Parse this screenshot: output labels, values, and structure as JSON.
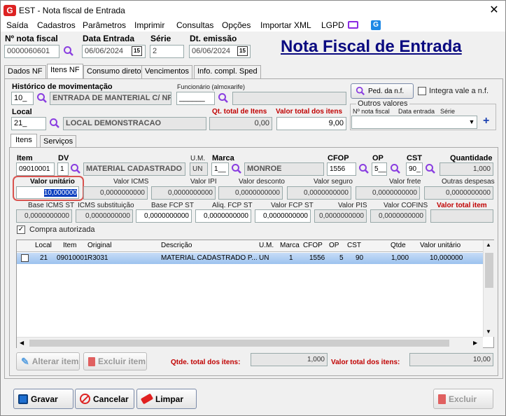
{
  "window": {
    "title": "EST - Nota fiscal de Entrada",
    "big_title": "Nota Fiscal de Entrada"
  },
  "menu": [
    "Saída",
    "Cadastros",
    "Parâmetros",
    "Imprimir",
    "Consultas",
    "Opções",
    "Importar XML",
    "LGPD"
  ],
  "header": {
    "nota_label": "Nº nota fiscal",
    "nota_value": "0000060601",
    "data_entrada_label": "Data Entrada",
    "data_entrada_value": "06/06/2024",
    "serie_label": "Série",
    "serie_value": "2",
    "emissao_label": "Dt. emissão",
    "emissao_value": "06/06/2024",
    "cal_glyph": "15"
  },
  "tabs": [
    "Dados NF",
    "Itens NF",
    "Consumo direto",
    "Vencimentos",
    "Info. compl. Sped"
  ],
  "historico": {
    "label": "Histórico de movimentação",
    "code": "10_",
    "desc": "ENTRADA DE MANTERIAL C/ NF"
  },
  "funcionario": {
    "label": "Funcionário (almoxarife)",
    "code": "______"
  },
  "ped_button": "Ped. da n.f.",
  "integra_label": "Integra vale a n.f.",
  "outros": {
    "legend": "Outros valores",
    "c1": "Nº nota fiscal",
    "c2": "Data entrada",
    "c3": "Série",
    "plus": "+"
  },
  "local": {
    "label": "Local",
    "code": "21_",
    "desc": "LOCAL DEMONSTRACAO"
  },
  "qt_total": {
    "label": "Qt. total de Itens",
    "value": "0,00"
  },
  "valor_total": {
    "label": "Valor total dos itens",
    "value": "9,00"
  },
  "subtabs": [
    "Itens",
    "Serviços"
  ],
  "item": {
    "item_label": "Item",
    "item_value": "09010001",
    "dv_label": "DV",
    "dv_value": "1",
    "desc_value": "MATERIAL CADASTRADO",
    "um_label": "U.M.",
    "um_value": "UN",
    "marca_label": "Marca",
    "marca_code": "1__",
    "marca_desc": "MONROE",
    "cfop_label": "CFOP",
    "cfop_value": "1556",
    "op_label": "OP",
    "op_value": "5__",
    "cst_label": "CST",
    "cst_value": "90_",
    "qtd_label": "Quantidade",
    "qtd_value": "1,000"
  },
  "row1": [
    {
      "label": "Valor unitário",
      "value": "10,000000"
    },
    {
      "label": "Valor ICMS",
      "value": "0,0000000000"
    },
    {
      "label": "Valor IPI",
      "value": "0,0000000000"
    },
    {
      "label": "Valor desconto",
      "value": "0,0000000000"
    },
    {
      "label": "Valor seguro",
      "value": "0,0000000000"
    },
    {
      "label": "Valor frete",
      "value": "0,0000000000"
    },
    {
      "label": "Outras despesas",
      "value": "0,0000000000"
    }
  ],
  "row2": [
    {
      "label": "Base ICMS ST",
      "value": "0,0000000000"
    },
    {
      "label": "ICMS substituição",
      "value": "0,0000000000"
    },
    {
      "label": "Base FCP ST",
      "value": "0,0000000000"
    },
    {
      "label": "Aliq. FCP ST",
      "value": "0,0000000000"
    },
    {
      "label": "Valor FCP ST",
      "value": "0,0000000000"
    },
    {
      "label": "Valor PIS",
      "value": "0,0000000000"
    },
    {
      "label": "Valor COFINS",
      "value": "0,0000000000"
    },
    {
      "label": "Valor total item",
      "value": ""
    }
  ],
  "compra_label": "Compra autorizada",
  "grid": {
    "headers": [
      "Local",
      "Item",
      "Original",
      "Descrição",
      "U.M.",
      "Marca",
      "CFOP",
      "OP",
      "CST",
      "Qtde",
      "Valor unitário"
    ],
    "rows": [
      [
        "21",
        "09010001",
        "R3031",
        "MATERIAL CADASTRADO P...",
        "UN",
        "1",
        "1556",
        "5",
        "90",
        "1,000",
        "10,000000"
      ]
    ]
  },
  "buttons": {
    "alterar": "Alterar item",
    "excluir_item": "Excluir item",
    "gravar": "Gravar",
    "cancelar": "Cancelar",
    "limpar": "Limpar",
    "excluir": "Excluir"
  },
  "totais": {
    "qtde_label": "Qtde. total dos itens:",
    "qtde_value": "1,000",
    "valor_label": "Valor total dos itens:",
    "valor_value": "10,00"
  }
}
